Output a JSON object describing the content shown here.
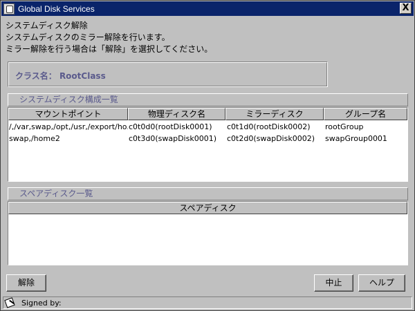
{
  "window": {
    "title": "Global Disk Services",
    "close_glyph": "X"
  },
  "description": {
    "line1": "システムディスク解除",
    "line2": "システムディスクのミラー解除を行います。",
    "line3": "ミラー解除を行う場合は「解除」を選択してください。"
  },
  "class_info": {
    "label": "クラス名：  RootClass"
  },
  "system_disk_section": {
    "title": "システムディスク構成一覧",
    "columns": [
      "マウントポイント",
      "物理ディスク名",
      "ミラーディスク",
      "グループ名"
    ],
    "rows": [
      [
        "/,/var,swap,/opt,/usr,/export/ho...",
        "c0t0d0(rootDisk0001)",
        "c0t1d0(rootDisk0002)",
        "rootGroup"
      ],
      [
        "swap,/home2",
        "c0t3d0(swapDisk0001)",
        "c0t2d0(swapDisk0002)",
        "swapGroup0001"
      ]
    ]
  },
  "spare_disk_section": {
    "title": "スペアディスク一覧",
    "columns": [
      "スペアディスク"
    ],
    "rows": []
  },
  "buttons": {
    "release": "解除",
    "cancel": "中止",
    "help": "ヘルプ"
  },
  "status_bar": {
    "text": "Signed by:"
  },
  "colors": {
    "titlebar": "#0a246a",
    "section_title_text": "#5a5a8c",
    "background": "#c0c0c0"
  }
}
